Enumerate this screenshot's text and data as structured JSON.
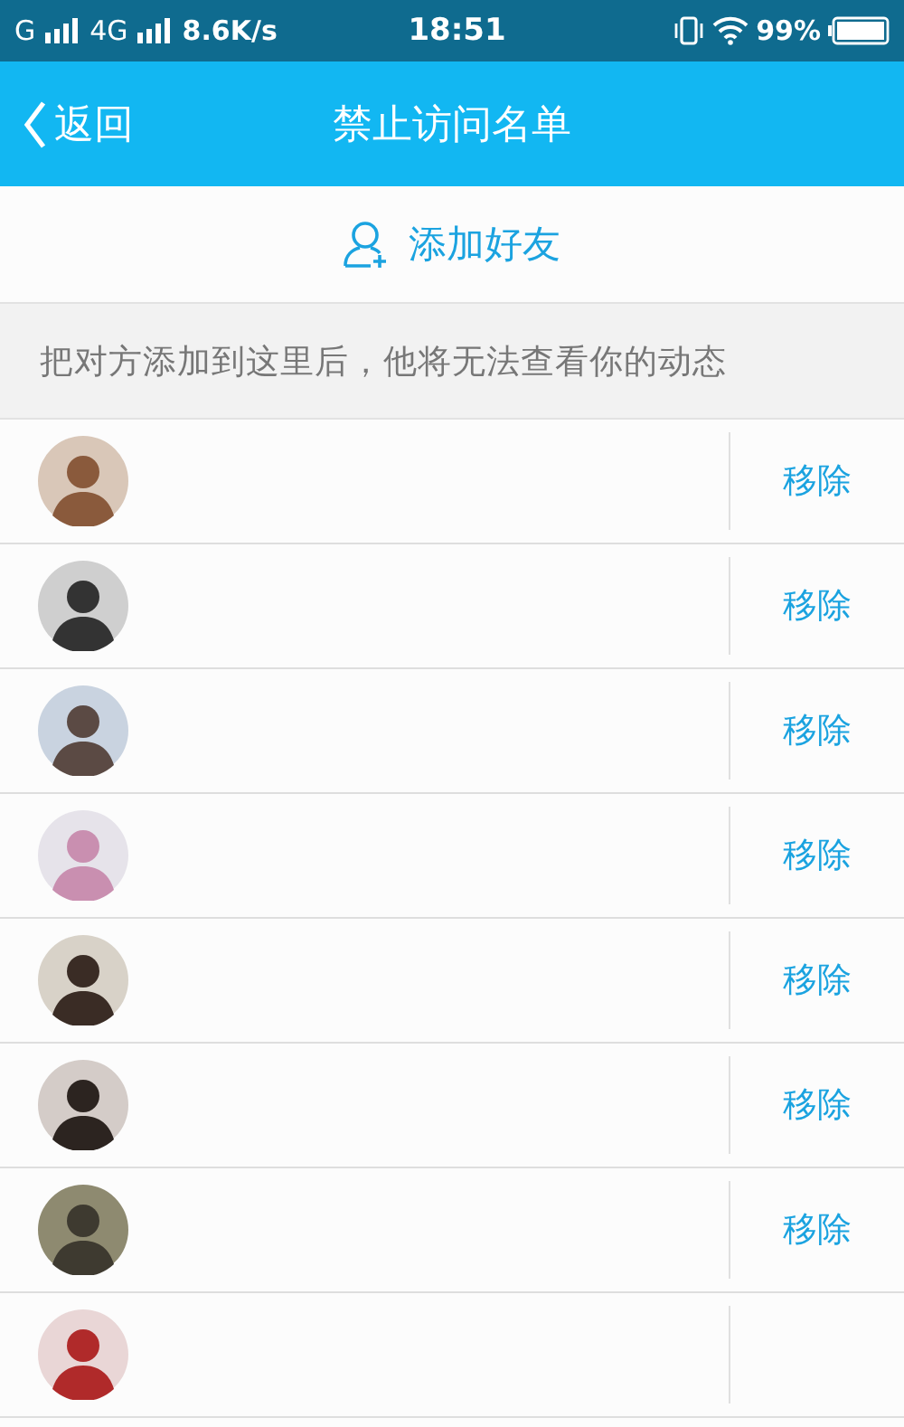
{
  "status_bar": {
    "carrier_1": "G",
    "carrier_2": "4G",
    "speed": "8.6K/s",
    "time": "18:51",
    "battery": "99%"
  },
  "header": {
    "back": "返回",
    "title": "禁止访问名单"
  },
  "add_friend": "添加好友",
  "notice": "把对方添加到这里后，他将无法查看你的动态",
  "contacts": [
    {
      "kind": "picture",
      "action": "移除"
    },
    {
      "kind": "picture",
      "action": "移除"
    },
    {
      "kind": "picture",
      "action": "移除"
    },
    {
      "kind": "picture",
      "action": "移除"
    },
    {
      "kind": "picture",
      "action": "移除"
    },
    {
      "kind": "picture",
      "action": "移除"
    },
    {
      "kind": "picture",
      "action": "移除"
    },
    {
      "kind": "picture"
    }
  ]
}
